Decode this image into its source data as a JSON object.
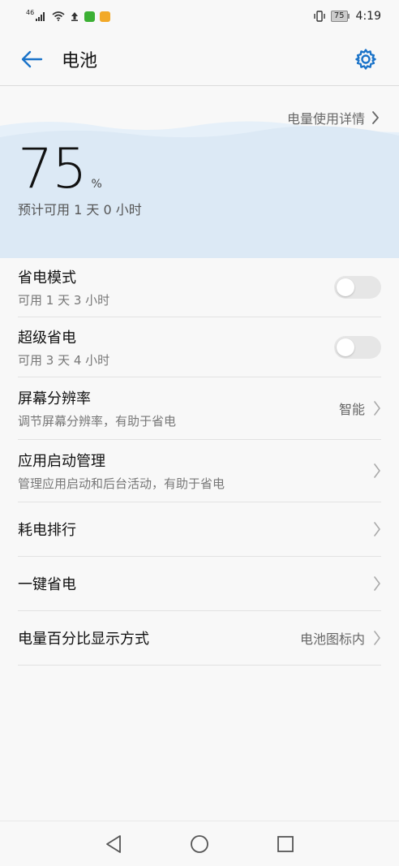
{
  "status_bar": {
    "network_label": "46",
    "battery_level": "75",
    "time": "4:19"
  },
  "header": {
    "title": "电池"
  },
  "battery": {
    "percent": "75",
    "unit": "%",
    "estimate": "预计可用 1 天 0 小时",
    "detail_link": "电量使用详情"
  },
  "settings": [
    {
      "title": "省电模式",
      "subtitle": "可用 1 天 3 小时",
      "control": "toggle",
      "enabled": false
    },
    {
      "title": "超级省电",
      "subtitle": "可用 3 天 4 小时",
      "control": "toggle",
      "enabled": false
    },
    {
      "title": "屏幕分辨率",
      "subtitle": "调节屏幕分辨率，有助于省电",
      "value": "智能",
      "control": "chevron"
    },
    {
      "title": "应用启动管理",
      "subtitle": "管理应用启动和后台活动，有助于省电",
      "control": "chevron"
    },
    {
      "title": "耗电排行",
      "control": "chevron"
    },
    {
      "title": "一键省电",
      "control": "chevron"
    },
    {
      "title": "电量百分比显示方式",
      "value": "电池图标内",
      "control": "chevron"
    }
  ],
  "colors": {
    "accent": "#1a73c9",
    "hero_wave": "#dce9f5",
    "toggle_off": "#e6e6e6"
  },
  "icons": {
    "back": "arrow-left-icon",
    "settings": "gear-icon",
    "chevron": "chevron-right-icon",
    "nav_back": "triangle-back-icon",
    "nav_home": "circle-home-icon",
    "nav_recent": "square-recent-icon"
  }
}
